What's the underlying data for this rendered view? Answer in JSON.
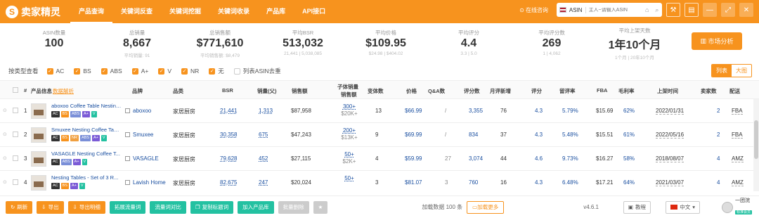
{
  "app": {
    "name": "卖家精灵"
  },
  "nav": [
    "产品查询",
    "关键词反查",
    "关键词挖掘",
    "关键词收录",
    "产品库",
    "API接口"
  ],
  "top": {
    "online": "在线咨询",
    "site": "ASIN",
    "search_placeholder": "主人~请输入ASIN"
  },
  "stats": [
    {
      "label": "ASIN数量",
      "value": "100",
      "sub": ""
    },
    {
      "label": "总销量",
      "value": "8,667",
      "sub": "平均销量: 91"
    },
    {
      "label": "总销售额",
      "value": "$771,610",
      "sub": "平均销售额: $8,479"
    },
    {
      "label": "平均BSR",
      "value": "513,032",
      "sub": "21,441 | 5,038,085"
    },
    {
      "label": "平均价格",
      "value": "$109.95",
      "sub": "$24.98 | $404.02"
    },
    {
      "label": "平均评分",
      "value": "4.4",
      "sub": "3.3 | 5.0"
    },
    {
      "label": "平均评分数",
      "value": "269",
      "sub": "1 | 4,062"
    },
    {
      "label": "平均上架天数",
      "value": "1年10个月",
      "sub": "1个月 | 20年10个月"
    }
  ],
  "market_btn": "市场分析",
  "filter": {
    "label": "按类型查看",
    "options": [
      "AC",
      "BS",
      "ABS",
      "A+",
      "V",
      "NR",
      "无"
    ],
    "dedupe": "列表ASIN去重"
  },
  "view": {
    "list": "列表",
    "grid": "大图"
  },
  "columns": [
    "#",
    "产品信息",
    "数据解析",
    "品牌",
    "品类",
    "BSR",
    "销量(父)",
    "销售额",
    "子体销量",
    "销售额",
    "变体数",
    "价格",
    "Q&A数",
    "评分数",
    "月评新增",
    "评分",
    "留评率",
    "FBA",
    "毛利率",
    "上架时间",
    "卖家数",
    "配送"
  ],
  "rows": [
    {
      "n": "1",
      "title": "aboxoo Coffee Table Nesting...",
      "tags": [
        "AC",
        "BS",
        "ABS",
        "A+",
        "V"
      ],
      "brand": "aboxoo",
      "cat": "家居厨房",
      "bsr": "21,441",
      "sales": "1,313",
      "rev": "$87,958",
      "child": "300+",
      "child_rev": "$20K+",
      "var": "13",
      "price": "$66.99",
      "qa": "/",
      "ratings": "3,355",
      "new": "76",
      "score": "4.3",
      "rate": "5.79%",
      "fba": "$15.69",
      "margin": "62%",
      "date": "2022/01/31",
      "sellers": "2",
      "ship": "FBA"
    },
    {
      "n": "2",
      "title": "Smuxee Nesting Coffee Table...",
      "tags": [
        "AC",
        "BS",
        "NR",
        "ABS",
        "A+",
        "V"
      ],
      "brand": "Smuxee",
      "cat": "家居厨房",
      "bsr": "30,358",
      "sales": "675",
      "rev": "$47,243",
      "child": "200+",
      "child_rev": "$13K+",
      "var": "9",
      "price": "$69.99",
      "qa": "/",
      "ratings": "834",
      "new": "37",
      "score": "4.3",
      "rate": "5.48%",
      "fba": "$15.51",
      "margin": "61%",
      "date": "2022/05/16",
      "sellers": "2",
      "ship": "FBA"
    },
    {
      "n": "3",
      "title": "VASAGLE Nesting Coffee T...",
      "tags": [
        "AC",
        "ABS",
        "A+",
        "V"
      ],
      "brand": "VASAGLE",
      "cat": "家居厨房",
      "bsr": "79,628",
      "sales": "452",
      "rev": "$27,115",
      "child": "50+",
      "child_rev": "$2K+",
      "var": "4",
      "price": "$59.99",
      "qa": "27",
      "ratings": "3,074",
      "new": "44",
      "score": "4.6",
      "rate": "9.73%",
      "fba": "$16.27",
      "margin": "58%",
      "date": "2018/08/07",
      "sellers": "4",
      "ship": "AMZ"
    },
    {
      "n": "4",
      "title": "Nesting Tables - Set of 3 R...",
      "tags": [
        "AC",
        "BS",
        "A+",
        "V"
      ],
      "brand": "Lavish Home",
      "cat": "家居厨房",
      "bsr": "82,675",
      "sales": "247",
      "rev": "$20,024",
      "child": "50+",
      "child_rev": "",
      "var": "3",
      "price": "$81.07",
      "qa": "3",
      "ratings": "760",
      "new": "16",
      "score": "4.3",
      "rate": "6.48%",
      "fba": "$17.21",
      "margin": "64%",
      "date": "2021/03/07",
      "sellers": "4",
      "ship": "AMZ"
    }
  ],
  "bottom": {
    "buttons": [
      "刷新",
      "导出",
      "导出明细",
      "拓展流量词",
      "流量词对比",
      "复制标题词",
      "加入产品库",
      "批量删除"
    ],
    "loaded": "加载数据 100 条",
    "loadmore": "加载更多",
    "version": "v4.6.1",
    "help": "教程",
    "lang": "中文",
    "user": "一团浣",
    "badge": "标准会员"
  },
  "colors": {
    "brand": "#f7931e",
    "green": "#23c1a1",
    "link": "#1a4fa0"
  }
}
